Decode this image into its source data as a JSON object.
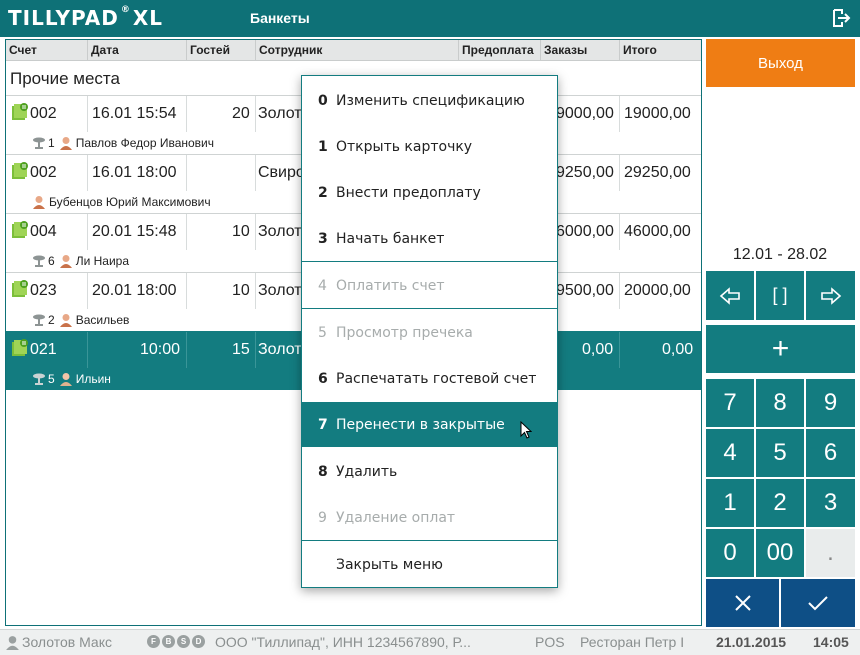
{
  "app": {
    "logo": "TILLYPAD",
    "logo_suffix": "XL",
    "screen_title": "Банкеты"
  },
  "columns": [
    "Счет",
    "Дата",
    "Гостей",
    "Сотрудник",
    "Предоплата",
    "Заказы",
    "Итого"
  ],
  "group_title": "Прочие места",
  "rows": [
    {
      "bill": "002",
      "date": "16.01 15:54",
      "guests": "20",
      "employee": "Золот",
      "orders": "9000,00",
      "total": "19000,00",
      "table": "1",
      "person": "Павлов Федор Иванович"
    },
    {
      "bill": "002",
      "date": "16.01 18:00",
      "guests": "",
      "employee": "Свиро",
      "orders": "9250,00",
      "total": "29250,00",
      "table": "",
      "person": "Бубенцов Юрий Максимович"
    },
    {
      "bill": "004",
      "date": "20.01 15:48",
      "guests": "10",
      "employee": "Золот",
      "orders": "6000,00",
      "total": "46000,00",
      "table": "6",
      "person": "Ли Наира"
    },
    {
      "bill": "023",
      "date": "20.01 18:00",
      "guests": "10",
      "employee": "Золот",
      "orders": "9500,00",
      "total": "20000,00",
      "table": "2",
      "person": "Васильев"
    },
    {
      "bill": "021",
      "date": "10:00",
      "guests": "15",
      "employee": "Золот",
      "orders": "0,00",
      "total": "0,00",
      "table": "5",
      "person": "Ильин"
    }
  ],
  "menu": {
    "items": [
      {
        "num": "0",
        "label": "Изменить спецификацию"
      },
      {
        "num": "1",
        "label": "Открыть карточку"
      },
      {
        "num": "2",
        "label": "Внести предоплату"
      },
      {
        "num": "3",
        "label": "Начать банкет"
      },
      {
        "num": "4",
        "label": "Оплатить счет"
      },
      {
        "num": "5",
        "label": "Просмотр пречека"
      },
      {
        "num": "6",
        "label": "Распечатать гостевой счет"
      },
      {
        "num": "7",
        "label": "Перенести в закрытые"
      },
      {
        "num": "8",
        "label": "Удалить"
      },
      {
        "num": "9",
        "label": "Удаление оплат"
      },
      {
        "num": "",
        "label": "Закрыть меню"
      }
    ]
  },
  "right": {
    "exit_label": "Выход",
    "date_range": "12.01 - 28.02",
    "nav_mid": "[ ]",
    "plus": "+",
    "keys": [
      "7",
      "8",
      "9",
      "4",
      "5",
      "6",
      "1",
      "2",
      "3",
      "0",
      "00",
      "."
    ]
  },
  "status": {
    "user": "Золотов Макс",
    "icon_letters": [
      "F",
      "B",
      "S",
      "D"
    ],
    "company": "ООО \"Тиллипад\", ИНН 1234567890, Р...",
    "pos": "POS",
    "restaurant": "Ресторан Петр I",
    "date": "21.01.2015",
    "time": "14:05"
  },
  "colors": {
    "teal": "#137c80",
    "orange": "#ef7d14",
    "dark_blue": "#0e4f86"
  }
}
